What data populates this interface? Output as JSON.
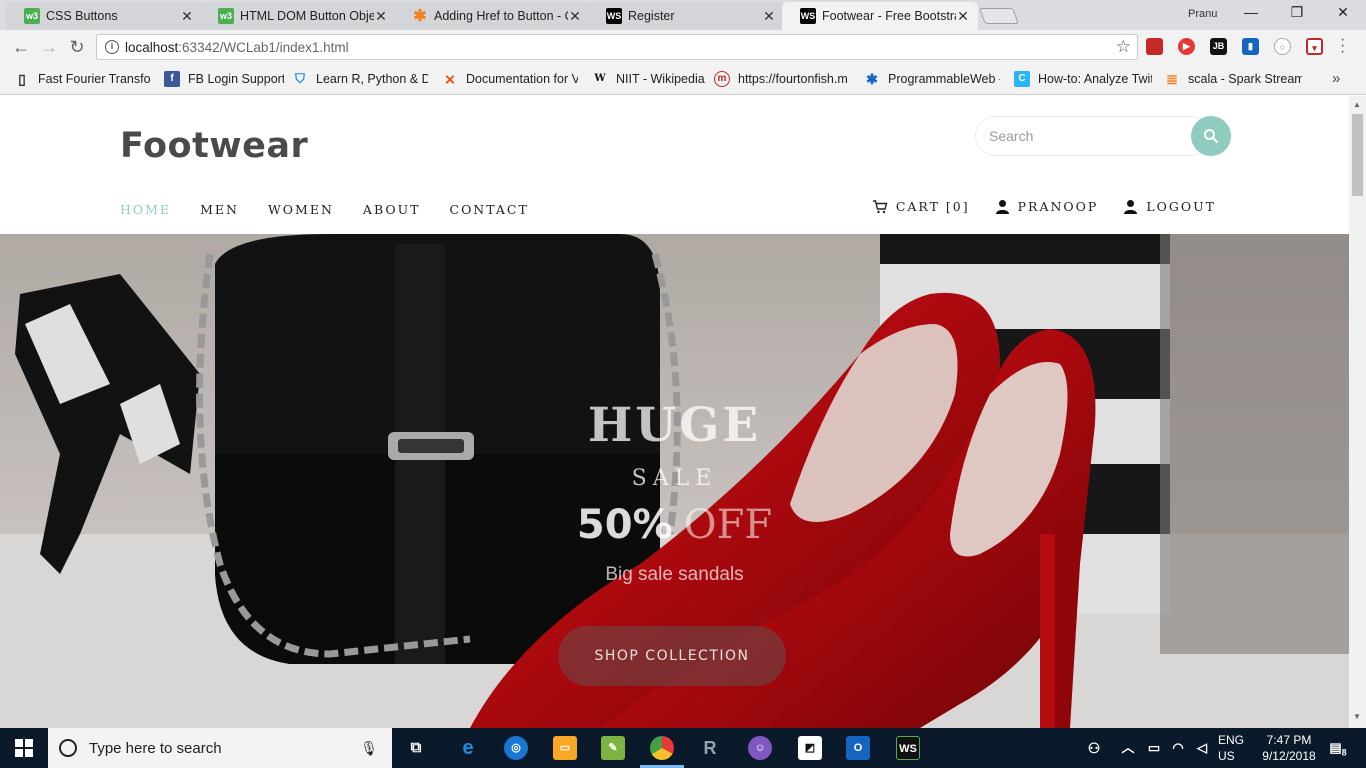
{
  "browser": {
    "tabs": [
      {
        "title": "CSS Buttons",
        "favicon": "w3schools-icon",
        "active": false
      },
      {
        "title": "HTML DOM Button Object",
        "favicon": "w3schools-icon",
        "active": false
      },
      {
        "title": "Adding Href to Button - C",
        "favicon": "stackoverflow-icon",
        "active": false
      },
      {
        "title": "Register",
        "favicon": "webstorm-icon",
        "active": false
      },
      {
        "title": "Footwear - Free Bootstrap",
        "favicon": "webstorm-icon",
        "active": true
      }
    ],
    "profile_name": "Pranu",
    "url_host": "localhost",
    "url_path": ":63342/WCLab1/index1.html",
    "bookmarks": [
      {
        "label": "Fast Fourier Transform",
        "icon": "page-icon"
      },
      {
        "label": "FB Login Support",
        "icon": "facebook-icon"
      },
      {
        "label": "Learn R, Python & Da",
        "icon": "shield-icon"
      },
      {
        "label": "Documentation for V",
        "icon": "vscode-icon"
      },
      {
        "label": "NIIT - Wikipedia",
        "icon": "wikipedia-icon"
      },
      {
        "label": "https://fourtonfish.m",
        "icon": "m-icon"
      },
      {
        "label": "ProgrammableWeb -",
        "icon": "puzzle-icon"
      },
      {
        "label": "How-to: Analyze Twit",
        "icon": "c-icon"
      },
      {
        "label": "scala - Spark Streamin",
        "icon": "stackoverflow-icon"
      }
    ]
  },
  "site": {
    "brand": "Footwear",
    "search_placeholder": "Search",
    "nav": [
      "HOME",
      "MEN",
      "WOMEN",
      "ABOUT",
      "CONTACT"
    ],
    "cart": "CART [0]",
    "user": "PRANOOP",
    "logout": "LOGOUT",
    "accent_color": "#8fcbbe"
  },
  "hero": {
    "headline": "HUGE",
    "subheadline": "SALE",
    "discount_value": "50%",
    "discount_word": "OFF",
    "tagline": "Big sale sandals",
    "cta": "SHOP COLLECTION"
  },
  "taskbar": {
    "search_placeholder": "Type here to search",
    "lang_top": "ENG",
    "lang_bottom": "US",
    "time": "7:47 PM",
    "date": "9/12/2018",
    "notifications": "8"
  }
}
